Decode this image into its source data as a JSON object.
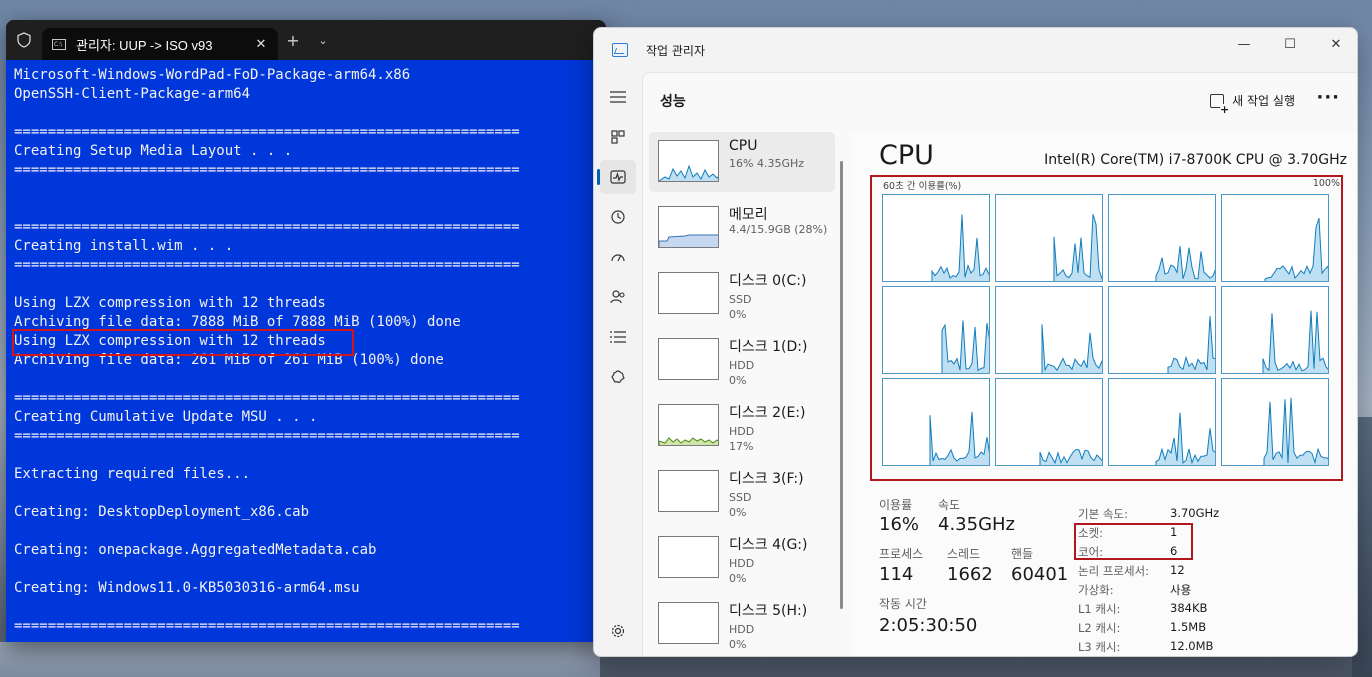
{
  "terminal": {
    "tab_title": "관리자:  UUP -> ISO v93",
    "tab_close": "✕",
    "new_tab": "+",
    "dropdown": "⌄",
    "lines": [
      "Microsoft-Windows-WordPad-FoD-Package-arm64.x86",
      "OpenSSH-Client-Package-arm64",
      "",
      "============================================================",
      "Creating Setup Media Layout . . .",
      "============================================================",
      "",
      "",
      "============================================================",
      "Creating install.wim . . .",
      "============================================================",
      "",
      "Using LZX compression with 12 threads",
      "Archiving file data: 7888 MiB of 7888 MiB (100%) done",
      "Using LZX compression with 12 threads",
      "Archiving file data: 261 MiB of 261 MiB (100%) done",
      "",
      "============================================================",
      "Creating Cumulative Update MSU . . .",
      "============================================================",
      "",
      "Extracting required files...",
      "",
      "Creating: DesktopDeployment_x86.cab",
      "",
      "Creating: onepackage.AggregatedMetadata.cab",
      "",
      "Creating: Windows11.0-KB5030316-arm64.msu",
      "",
      "============================================================"
    ],
    "bg_color": "#0037da"
  },
  "taskmgr": {
    "window_title": "작업 관리자",
    "page_title": "성능",
    "run_new_task": "새 작업 실행",
    "more": "···",
    "win_buttons": {
      "minimize": "—",
      "maximize": "☐",
      "close": "✕"
    },
    "devices": [
      {
        "name": "CPU",
        "line1": "16% 4.35GHz",
        "line2": ""
      },
      {
        "name": "메모리",
        "line1": "4.4/15.9GB (28%)",
        "line2": ""
      },
      {
        "name": "디스크 0(C:)",
        "line1": "SSD",
        "line2": "0%"
      },
      {
        "name": "디스크 1(D:)",
        "line1": "HDD",
        "line2": "0%"
      },
      {
        "name": "디스크 2(E:)",
        "line1": "HDD",
        "line2": "17%"
      },
      {
        "name": "디스크 3(F:)",
        "line1": "SSD",
        "line2": "0%"
      },
      {
        "name": "디스크 4(G:)",
        "line1": "HDD",
        "line2": "0%"
      },
      {
        "name": "디스크 5(H:)",
        "line1": "HDD",
        "line2": "0%"
      }
    ],
    "cpu": {
      "title": "CPU",
      "model": "Intel(R) Core(TM) i7-8700K CPU @ 3.70GHz",
      "graph_label": "60초 간 이용률(%)",
      "graph_max": "100%",
      "utilization_label": "이용률",
      "utilization": "16%",
      "speed_label": "속도",
      "speed": "4.35GHz",
      "processes_label": "프로세스",
      "processes": "114",
      "threads_label": "스레드",
      "threads": "1662",
      "handles_label": "핸들",
      "handles": "60401",
      "uptime_label": "작동 시간",
      "uptime": "2:05:30:50",
      "specs": [
        {
          "key": "기본 속도:",
          "value": "3.70GHz"
        },
        {
          "key": "소켓:",
          "value": "1"
        },
        {
          "key": "코어:",
          "value": "6"
        },
        {
          "key": "논리 프로세서:",
          "value": "12"
        },
        {
          "key": "가상화:",
          "value": "사용"
        },
        {
          "key": "L1 캐시:",
          "value": "384KB"
        },
        {
          "key": "L2 캐시:",
          "value": "1.5MB"
        },
        {
          "key": "L3 캐시:",
          "value": "12.0MB"
        }
      ],
      "accent_color": "#117dbb",
      "fill_color": "#bfe0f2"
    }
  }
}
